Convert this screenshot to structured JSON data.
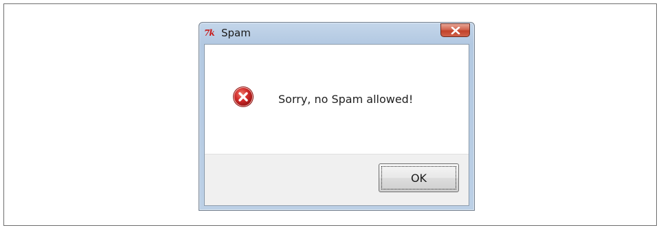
{
  "window": {
    "title": "Spam",
    "app_icon_text": "7k",
    "app_icon": "tk-feather-icon",
    "close_icon": "close-icon"
  },
  "dialog": {
    "icon": "error-icon",
    "message": "Sorry, no Spam allowed!",
    "ok_label": "OK"
  },
  "colors": {
    "error_red": "#d02a2a",
    "close_button_red": "#c2422a",
    "titlebar_blue": "#b3c9e2"
  }
}
